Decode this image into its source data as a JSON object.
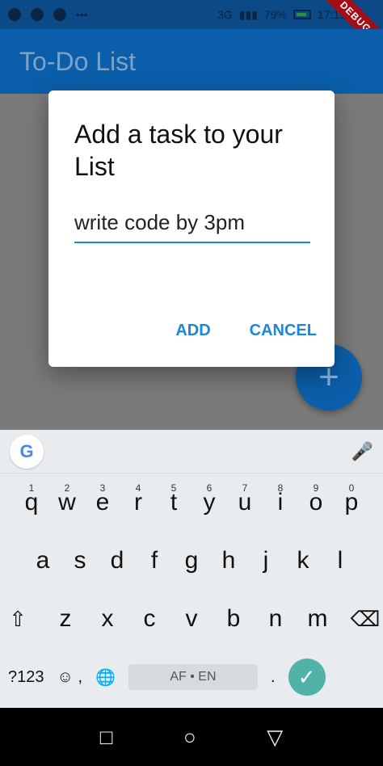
{
  "status_bar": {
    "battery_text": "79%",
    "time": "17:15",
    "network_label": "3G"
  },
  "app_bar": {
    "title": "To-Do List"
  },
  "debug_ribbon": {
    "text": "DEBUG"
  },
  "dialog": {
    "title": "Add a task to your List",
    "input_value": "write code by 3pm",
    "actions": {
      "add": "ADD",
      "cancel": "CANCEL"
    }
  },
  "fab": {
    "label": "+"
  },
  "keyboard": {
    "google_letter": "G",
    "mic_icon": "mic-icon",
    "row1": [
      {
        "key": "q",
        "num": "1"
      },
      {
        "key": "w",
        "num": "2"
      },
      {
        "key": "e",
        "num": "3"
      },
      {
        "key": "r",
        "num": "4"
      },
      {
        "key": "t",
        "num": "5"
      },
      {
        "key": "y",
        "num": "6"
      },
      {
        "key": "u",
        "num": "7"
      },
      {
        "key": "i",
        "num": "8"
      },
      {
        "key": "o",
        "num": "9"
      },
      {
        "key": "p",
        "num": "0"
      }
    ],
    "row2": [
      "a",
      "s",
      "d",
      "f",
      "g",
      "h",
      "j",
      "k",
      "l"
    ],
    "row3": [
      "z",
      "x",
      "c",
      "v",
      "b",
      "n",
      "m"
    ],
    "row4": {
      "symbols": "?123",
      "emoji_comma": ",",
      "space": "AF • EN",
      "period": "."
    }
  },
  "nav_bar": {
    "square": "□",
    "circle": "○",
    "triangle": "▽"
  }
}
